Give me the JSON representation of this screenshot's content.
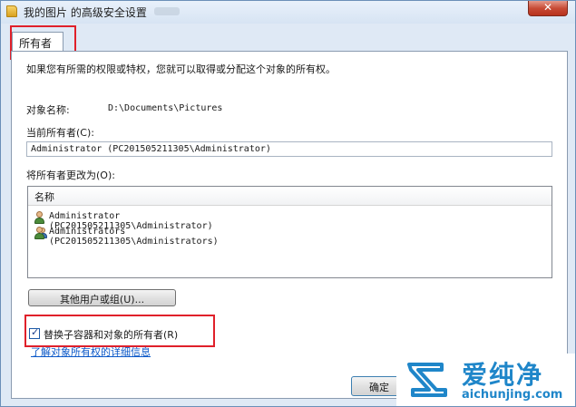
{
  "window": {
    "title": "我的图片 的高级安全设置",
    "close_glyph": "✕"
  },
  "tabs": [
    {
      "label": "所有者",
      "selected": true
    }
  ],
  "owner_page": {
    "instruction": "如果您有所需的权限或特权，您就可以取得或分配这个对象的所有权。",
    "object_name_label": "对象名称:",
    "object_name_value": "D:\\Documents\\Pictures",
    "current_owner_label": "当前所有者(C):",
    "current_owner_value": "Administrator (PC201505211305\\Administrator)",
    "change_owner_label": "将所有者更改为(O):",
    "list_header": "名称",
    "owner_candidates": [
      {
        "name": "Administrator (PC201505211305\\Administrator)",
        "icon": "user-icon"
      },
      {
        "name": "Administrators (PC201505211305\\Administrators)",
        "icon": "users-icon"
      }
    ],
    "other_users_button": "其他用户或组(U)...",
    "replace_owner_checkbox": {
      "label": "替换子容器和对象的所有者(R)",
      "checked": true
    },
    "learn_more_link": "了解对象所有权的详细信息"
  },
  "footer": {
    "ok_button": "确定"
  },
  "watermark": {
    "brand_cn": "爱纯净",
    "brand_url": "aichunjing.com"
  },
  "colors": {
    "highlight_box": "#e0202a",
    "link": "#0b58c8",
    "watermark": "#1f86c9"
  }
}
